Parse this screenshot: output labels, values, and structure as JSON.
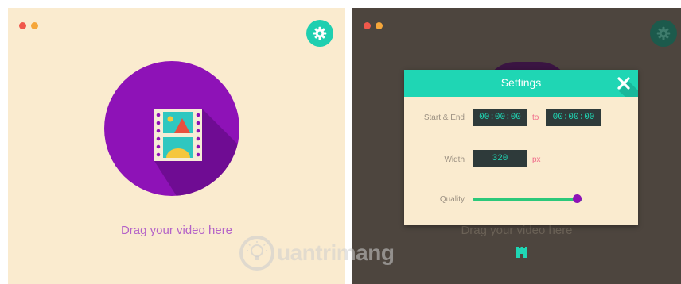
{
  "left_window": {
    "drop_label": "Drag your video here",
    "settings_icon": "gear-icon",
    "media_icon": "film-strip-icon"
  },
  "right_window": {
    "background_label": "Drag your video here",
    "settings_icon": "gear-icon",
    "bottom_icon": "castle-icon",
    "settings_modal": {
      "title": "Settings",
      "close_icon": "close-icon",
      "start_end": {
        "label": "Start & End",
        "start_value": "00:00:00",
        "separator": "to",
        "end_value": "00:00:00"
      },
      "width": {
        "label": "Width",
        "value": "320",
        "unit": "px"
      },
      "quality": {
        "label": "Quality",
        "level": 0.95
      }
    }
  },
  "watermark": {
    "text": "uantrimang"
  },
  "colors": {
    "left_background": "#faebcf",
    "right_background": "#4d453e",
    "accent_teal": "#1fd6b4",
    "accent_purple": "#8e12b7",
    "slider_green": "#2bc87a",
    "unit_pink": "#f06a8a",
    "dot_red": "#f0584b",
    "dot_orange": "#f5a63a"
  }
}
